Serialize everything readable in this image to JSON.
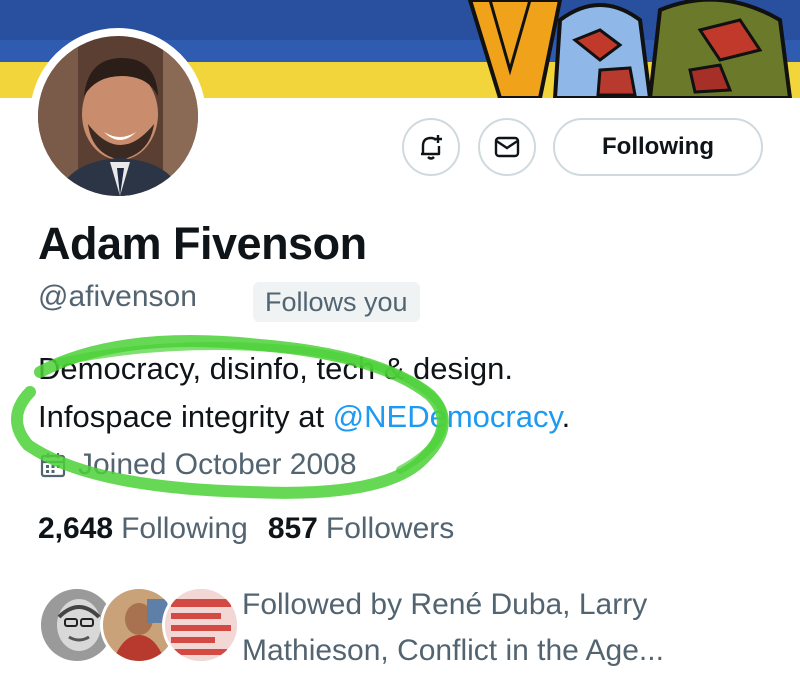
{
  "profile": {
    "display_name": "Adam Fivenson",
    "handle": "@afivenson",
    "follows_you_badge": "Follows you",
    "bio_line1": "Democracy, disinfo, tech & design.",
    "bio_line2_prefix": "Infospace integrity at ",
    "bio_mention": "@NEDemocracy",
    "bio_line2_suffix": ".",
    "joined": "Joined October 2008"
  },
  "actions": {
    "notify_icon": "bell-plus-icon",
    "message_icon": "envelope-icon",
    "following_label": "Following"
  },
  "stats": {
    "following_count": "2,648",
    "following_label": "Following",
    "followers_count": "857",
    "followers_label": "Followers"
  },
  "followed_by": {
    "text": "Followed by René Duba, Larry Mathieson, Conflict in the Age..."
  },
  "colors": {
    "banner_blue": "#2f5bb0",
    "banner_yellow": "#f2d43b",
    "link": "#1d9bf0",
    "secondary_text": "#536471",
    "border": "#cfd9de",
    "highlighter": "#4cd137"
  }
}
